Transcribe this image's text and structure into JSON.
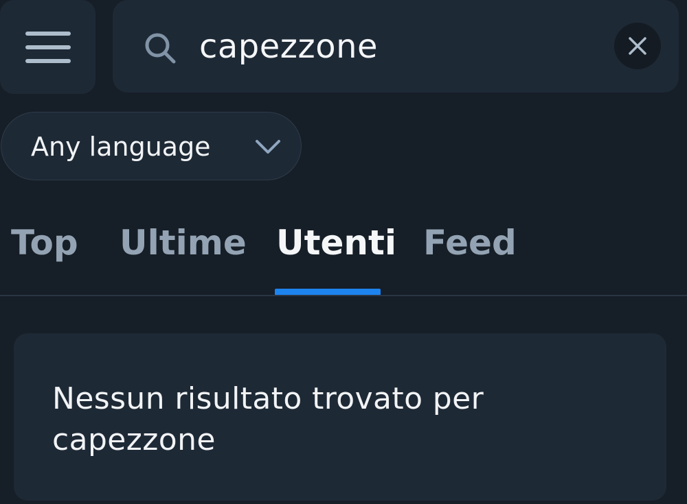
{
  "header": {
    "menu_icon": "hamburger-menu-icon",
    "search": {
      "icon": "search-icon",
      "value": "capezzone",
      "clear_icon": "close-icon"
    }
  },
  "filter": {
    "language": {
      "selected": "Any language",
      "icon": "chevron-down-icon"
    }
  },
  "tabs": [
    {
      "label": "Top",
      "active": false
    },
    {
      "label": "Ultime",
      "active": false
    },
    {
      "label": "Utenti",
      "active": true
    },
    {
      "label": "Feed",
      "active": false
    }
  ],
  "results": {
    "empty_message_line1": "Nessun risultato trovato per",
    "empty_message_line2": "capezzone"
  },
  "colors": {
    "background": "#161e27",
    "surface": "#1e2936",
    "accent": "#1d84ef",
    "inactive_tab": "#93a3b3",
    "text": "#f1f3f5"
  }
}
